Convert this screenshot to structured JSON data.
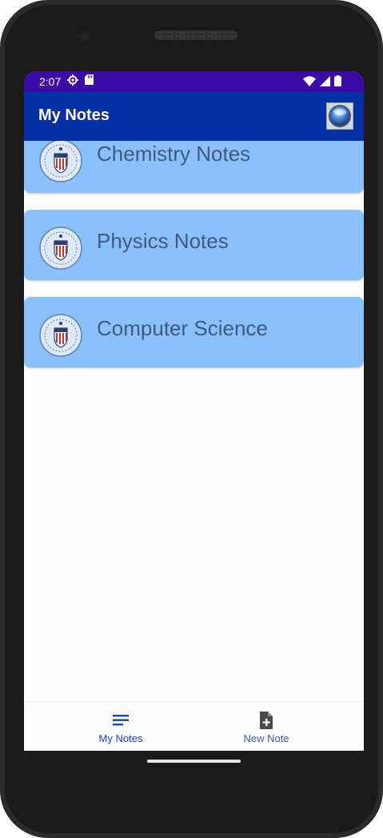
{
  "status_bar": {
    "time": "2:07",
    "icons": [
      "settings-gear-icon",
      "sd-card-icon",
      "wifi-icon",
      "signal-icon",
      "battery-icon"
    ],
    "background": "#3c0aa8"
  },
  "app_bar": {
    "title": "My Notes",
    "background": "#0430a4",
    "avatar_icon": "profile-orb-icon"
  },
  "notes": [
    {
      "title": "Chemistry Notes",
      "icon": "school-seal-icon"
    },
    {
      "title": "Physics Notes",
      "icon": "school-seal-icon"
    },
    {
      "title": "Computer Science",
      "icon": "school-seal-icon"
    }
  ],
  "note_card_color": "#8ac1fd",
  "bottom_nav": {
    "items": [
      {
        "label": "My Notes",
        "icon": "notes-list-icon",
        "active": true,
        "color": "#1a46b4"
      },
      {
        "label": "New Note",
        "icon": "add-note-icon",
        "active": false,
        "color": "#3b5ea8"
      }
    ]
  }
}
